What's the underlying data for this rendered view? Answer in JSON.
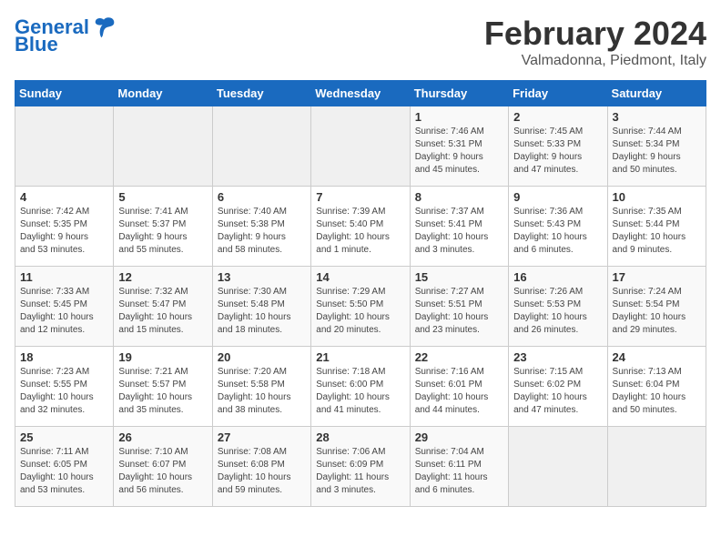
{
  "logo": {
    "text_general": "General",
    "text_blue": "Blue"
  },
  "title": "February 2024",
  "subtitle": "Valmadonna, Piedmont, Italy",
  "weekdays": [
    "Sunday",
    "Monday",
    "Tuesday",
    "Wednesday",
    "Thursday",
    "Friday",
    "Saturday"
  ],
  "weeks": [
    [
      {
        "day": "",
        "info": ""
      },
      {
        "day": "",
        "info": ""
      },
      {
        "day": "",
        "info": ""
      },
      {
        "day": "",
        "info": ""
      },
      {
        "day": "1",
        "info": "Sunrise: 7:46 AM\nSunset: 5:31 PM\nDaylight: 9 hours\nand 45 minutes."
      },
      {
        "day": "2",
        "info": "Sunrise: 7:45 AM\nSunset: 5:33 PM\nDaylight: 9 hours\nand 47 minutes."
      },
      {
        "day": "3",
        "info": "Sunrise: 7:44 AM\nSunset: 5:34 PM\nDaylight: 9 hours\nand 50 minutes."
      }
    ],
    [
      {
        "day": "4",
        "info": "Sunrise: 7:42 AM\nSunset: 5:35 PM\nDaylight: 9 hours\nand 53 minutes."
      },
      {
        "day": "5",
        "info": "Sunrise: 7:41 AM\nSunset: 5:37 PM\nDaylight: 9 hours\nand 55 minutes."
      },
      {
        "day": "6",
        "info": "Sunrise: 7:40 AM\nSunset: 5:38 PM\nDaylight: 9 hours\nand 58 minutes."
      },
      {
        "day": "7",
        "info": "Sunrise: 7:39 AM\nSunset: 5:40 PM\nDaylight: 10 hours\nand 1 minute."
      },
      {
        "day": "8",
        "info": "Sunrise: 7:37 AM\nSunset: 5:41 PM\nDaylight: 10 hours\nand 3 minutes."
      },
      {
        "day": "9",
        "info": "Sunrise: 7:36 AM\nSunset: 5:43 PM\nDaylight: 10 hours\nand 6 minutes."
      },
      {
        "day": "10",
        "info": "Sunrise: 7:35 AM\nSunset: 5:44 PM\nDaylight: 10 hours\nand 9 minutes."
      }
    ],
    [
      {
        "day": "11",
        "info": "Sunrise: 7:33 AM\nSunset: 5:45 PM\nDaylight: 10 hours\nand 12 minutes."
      },
      {
        "day": "12",
        "info": "Sunrise: 7:32 AM\nSunset: 5:47 PM\nDaylight: 10 hours\nand 15 minutes."
      },
      {
        "day": "13",
        "info": "Sunrise: 7:30 AM\nSunset: 5:48 PM\nDaylight: 10 hours\nand 18 minutes."
      },
      {
        "day": "14",
        "info": "Sunrise: 7:29 AM\nSunset: 5:50 PM\nDaylight: 10 hours\nand 20 minutes."
      },
      {
        "day": "15",
        "info": "Sunrise: 7:27 AM\nSunset: 5:51 PM\nDaylight: 10 hours\nand 23 minutes."
      },
      {
        "day": "16",
        "info": "Sunrise: 7:26 AM\nSunset: 5:53 PM\nDaylight: 10 hours\nand 26 minutes."
      },
      {
        "day": "17",
        "info": "Sunrise: 7:24 AM\nSunset: 5:54 PM\nDaylight: 10 hours\nand 29 minutes."
      }
    ],
    [
      {
        "day": "18",
        "info": "Sunrise: 7:23 AM\nSunset: 5:55 PM\nDaylight: 10 hours\nand 32 minutes."
      },
      {
        "day": "19",
        "info": "Sunrise: 7:21 AM\nSunset: 5:57 PM\nDaylight: 10 hours\nand 35 minutes."
      },
      {
        "day": "20",
        "info": "Sunrise: 7:20 AM\nSunset: 5:58 PM\nDaylight: 10 hours\nand 38 minutes."
      },
      {
        "day": "21",
        "info": "Sunrise: 7:18 AM\nSunset: 6:00 PM\nDaylight: 10 hours\nand 41 minutes."
      },
      {
        "day": "22",
        "info": "Sunrise: 7:16 AM\nSunset: 6:01 PM\nDaylight: 10 hours\nand 44 minutes."
      },
      {
        "day": "23",
        "info": "Sunrise: 7:15 AM\nSunset: 6:02 PM\nDaylight: 10 hours\nand 47 minutes."
      },
      {
        "day": "24",
        "info": "Sunrise: 7:13 AM\nSunset: 6:04 PM\nDaylight: 10 hours\nand 50 minutes."
      }
    ],
    [
      {
        "day": "25",
        "info": "Sunrise: 7:11 AM\nSunset: 6:05 PM\nDaylight: 10 hours\nand 53 minutes."
      },
      {
        "day": "26",
        "info": "Sunrise: 7:10 AM\nSunset: 6:07 PM\nDaylight: 10 hours\nand 56 minutes."
      },
      {
        "day": "27",
        "info": "Sunrise: 7:08 AM\nSunset: 6:08 PM\nDaylight: 10 hours\nand 59 minutes."
      },
      {
        "day": "28",
        "info": "Sunrise: 7:06 AM\nSunset: 6:09 PM\nDaylight: 11 hours\nand 3 minutes."
      },
      {
        "day": "29",
        "info": "Sunrise: 7:04 AM\nSunset: 6:11 PM\nDaylight: 11 hours\nand 6 minutes."
      },
      {
        "day": "",
        "info": ""
      },
      {
        "day": "",
        "info": ""
      }
    ]
  ]
}
